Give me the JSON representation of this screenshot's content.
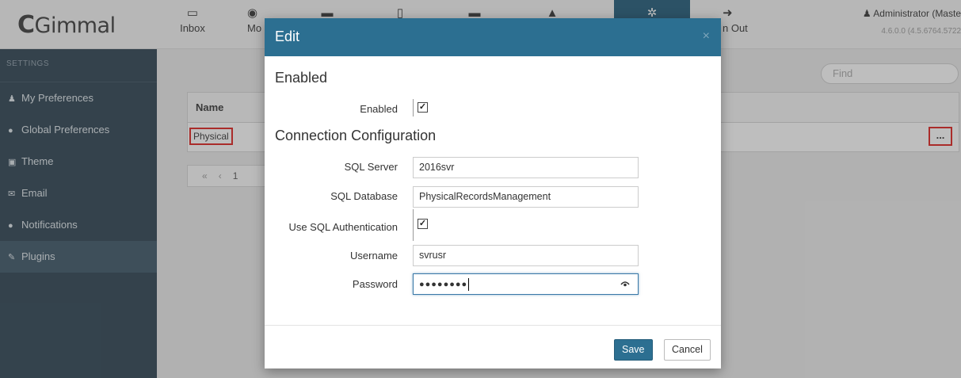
{
  "app": {
    "logo_text": "Gimmal",
    "logo_mark": "C",
    "nav": [
      {
        "label": "Inbox",
        "icon": "inbox-icon",
        "glyph": "▭"
      },
      {
        "label": "Mo",
        "icon": "eye-icon",
        "glyph": "◉"
      },
      {
        "label": "",
        "icon": "briefcase-icon",
        "glyph": "▬"
      },
      {
        "label": "",
        "icon": "document-icon",
        "glyph": "▯"
      },
      {
        "label": "",
        "icon": "archive-icon",
        "glyph": "▬"
      },
      {
        "label": "",
        "icon": "lock-icon",
        "glyph": "▲"
      },
      {
        "label": "",
        "icon": "gears-icon",
        "glyph": "✲"
      },
      {
        "label": "n Out",
        "icon": "sign-out-icon",
        "glyph": "➜"
      }
    ],
    "user": "Administrator (Maste",
    "version": "4.6.0.0 (4.5.6764.5722"
  },
  "sidebar": {
    "title": "SETTINGS",
    "items": [
      {
        "label": "My Preferences",
        "icon": "user-icon",
        "glyph": "♟"
      },
      {
        "label": "Global Preferences",
        "icon": "globe-icon",
        "glyph": "●"
      },
      {
        "label": "Theme",
        "icon": "image-icon",
        "glyph": "▣"
      },
      {
        "label": "Email",
        "icon": "envelope-icon",
        "glyph": "✉"
      },
      {
        "label": "Notifications",
        "icon": "comment-icon",
        "glyph": "●"
      },
      {
        "label": "Plugins",
        "icon": "plug-icon",
        "glyph": "✎"
      }
    ],
    "active": "Plugins"
  },
  "main": {
    "find_placeholder": "Find",
    "table_header": "Name",
    "row_name": "Physical",
    "row_action": "...",
    "pager": {
      "first": "«",
      "prev": "‹",
      "page": "1"
    }
  },
  "modal": {
    "title": "Edit",
    "close": "×",
    "section_enabled": "Enabled",
    "enabled_label": "Enabled",
    "enabled_checked": true,
    "section_connection": "Connection Configuration",
    "sql_server_label": "SQL Server",
    "sql_server_value": "2016svr",
    "sql_database_label": "SQL Database",
    "sql_database_value": "PhysicalRecordsManagement",
    "sql_auth_label": "Use SQL Authentication",
    "sql_auth_checked": true,
    "username_label": "Username",
    "username_value": "svrusr",
    "password_label": "Password",
    "password_mask": "●●●●●●●●",
    "save_label": "Save",
    "cancel_label": "Cancel"
  },
  "colors": {
    "header_blue": "#2c6f91",
    "sidebar": "#2b4150",
    "highlight_red": "#e0201c"
  }
}
